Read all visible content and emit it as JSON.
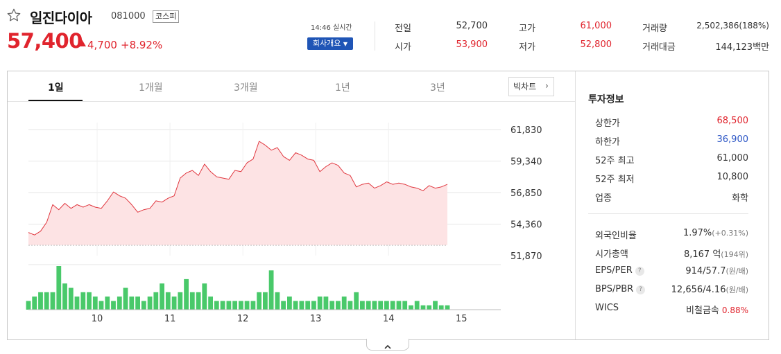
{
  "stock": {
    "name": "일진다이아",
    "code": "081000",
    "market": "코스피",
    "price": "57,400",
    "change": "4,700",
    "change_pct": "+8.92%"
  },
  "status": {
    "time": "14:46 실시간",
    "company_button": "회사개요"
  },
  "quote": [
    {
      "label": "전일",
      "value": "52,700",
      "color": "normal"
    },
    {
      "label": "시가",
      "value": "53,900",
      "color": "red"
    },
    {
      "label": "고가",
      "value": "61,000",
      "color": "red"
    },
    {
      "label": "저가",
      "value": "52,800",
      "color": "red"
    },
    {
      "label": "거래량",
      "value": "2,502,386(188%)",
      "color": "normal"
    },
    {
      "label": "거래대금",
      "value": "144,123백만",
      "color": "normal"
    }
  ],
  "tabs": [
    "1일",
    "1개월",
    "3개월",
    "1년",
    "3년"
  ],
  "active_tab": "1일",
  "big_chart_label": "빅차트",
  "invest": {
    "title": "투자정보",
    "rows": [
      {
        "label": "상한가",
        "value": "68,500",
        "color": "red"
      },
      {
        "label": "하한가",
        "value": "36,900",
        "color": "blue"
      },
      {
        "label": "52주 최고",
        "value": "61,000",
        "color": "normal"
      },
      {
        "label": "52주 최저",
        "value": "10,800",
        "color": "normal"
      },
      {
        "label": "업종",
        "value": "화학",
        "color": "normal"
      }
    ],
    "rows2": [
      {
        "label": "외국인비율",
        "value": "1.97%",
        "sub": "(+0.31%)",
        "help": false
      },
      {
        "label": "시가총액",
        "value": "8,167 억",
        "sub": "(194위)",
        "help": false
      },
      {
        "label": "EPS/PER",
        "value": "914/57.7",
        "sub": "(원/배)",
        "help": true
      },
      {
        "label": "BPS/PBR",
        "value": "12,656/4.16",
        "sub": "(원/배)",
        "help": true
      },
      {
        "label": "WICS",
        "value": "비철금속",
        "sub": "0.88%",
        "help": false
      }
    ]
  },
  "colors": {
    "up": "#e0242d",
    "down": "#2b55c5",
    "line": "#e0353d",
    "area": "#fde3e4",
    "volume": "#49c96a",
    "button": "#1f55b6"
  },
  "chart_data": {
    "type": "line",
    "x_ticks": [
      "10",
      "11",
      "12",
      "13",
      "14",
      "15"
    ],
    "y_ticks": [
      "61,830",
      "59,340",
      "56,850",
      "54,360",
      "51,870"
    ],
    "ylim": [
      51870,
      61830
    ],
    "prev_close": 52700,
    "x": [
      "9:00",
      "9:05",
      "9:10",
      "9:15",
      "9:20",
      "9:25",
      "9:30",
      "9:35",
      "9:40",
      "9:45",
      "9:50",
      "9:55",
      "10:00",
      "10:05",
      "10:10",
      "10:15",
      "10:20",
      "10:25",
      "10:30",
      "10:35",
      "10:40",
      "10:45",
      "10:50",
      "10:55",
      "11:00",
      "11:05",
      "11:10",
      "11:15",
      "11:20",
      "11:25",
      "11:30",
      "11:35",
      "11:40",
      "11:45",
      "11:50",
      "11:55",
      "12:00",
      "12:05",
      "12:10",
      "12:15",
      "12:20",
      "12:25",
      "12:30",
      "12:35",
      "12:40",
      "12:45",
      "12:50",
      "12:55",
      "13:00",
      "13:05",
      "13:10",
      "13:15",
      "13:20",
      "13:25",
      "13:30",
      "13:35",
      "13:40",
      "13:45",
      "13:50",
      "13:55",
      "14:00",
      "14:05",
      "14:10",
      "14:15",
      "14:20",
      "14:25",
      "14:30",
      "14:35",
      "14:40",
      "14:45"
    ],
    "series": [
      {
        "values": [
          53700,
          53500,
          53800,
          54500,
          55900,
          55500,
          56000,
          55600,
          55900,
          55700,
          55900,
          55700,
          55600,
          56200,
          56900,
          56600,
          56400,
          55900,
          55300,
          55500,
          55600,
          56200,
          56100,
          56400,
          56600,
          58000,
          58400,
          58600,
          58200,
          59100,
          58500,
          58100,
          58000,
          57900,
          58600,
          58500,
          59200,
          59500,
          60900,
          60600,
          60200,
          60400,
          59700,
          59400,
          60000,
          59800,
          59500,
          59400,
          58500,
          58900,
          59200,
          59000,
          58400,
          58200,
          57300,
          57500,
          57600,
          57200,
          57400,
          57700,
          57500,
          57600,
          57500,
          57300,
          57200,
          57000,
          57400,
          57200,
          57300,
          57500
        ]
      }
    ],
    "volume": [
      2,
      3,
      4,
      4,
      4,
      10,
      6,
      5,
      3,
      4,
      4,
      3,
      2,
      3,
      2,
      3,
      5,
      3,
      3,
      2,
      3,
      4,
      6,
      4,
      3,
      4,
      7,
      4,
      4,
      6,
      3,
      2,
      2,
      2,
      2,
      2,
      2,
      2,
      4,
      4,
      9,
      4,
      2,
      3,
      2,
      2,
      2,
      2,
      3,
      3,
      2,
      2,
      3,
      2,
      4,
      2,
      2,
      2,
      2,
      2,
      2,
      2,
      2,
      1,
      2,
      1,
      1,
      2,
      1,
      1
    ]
  }
}
